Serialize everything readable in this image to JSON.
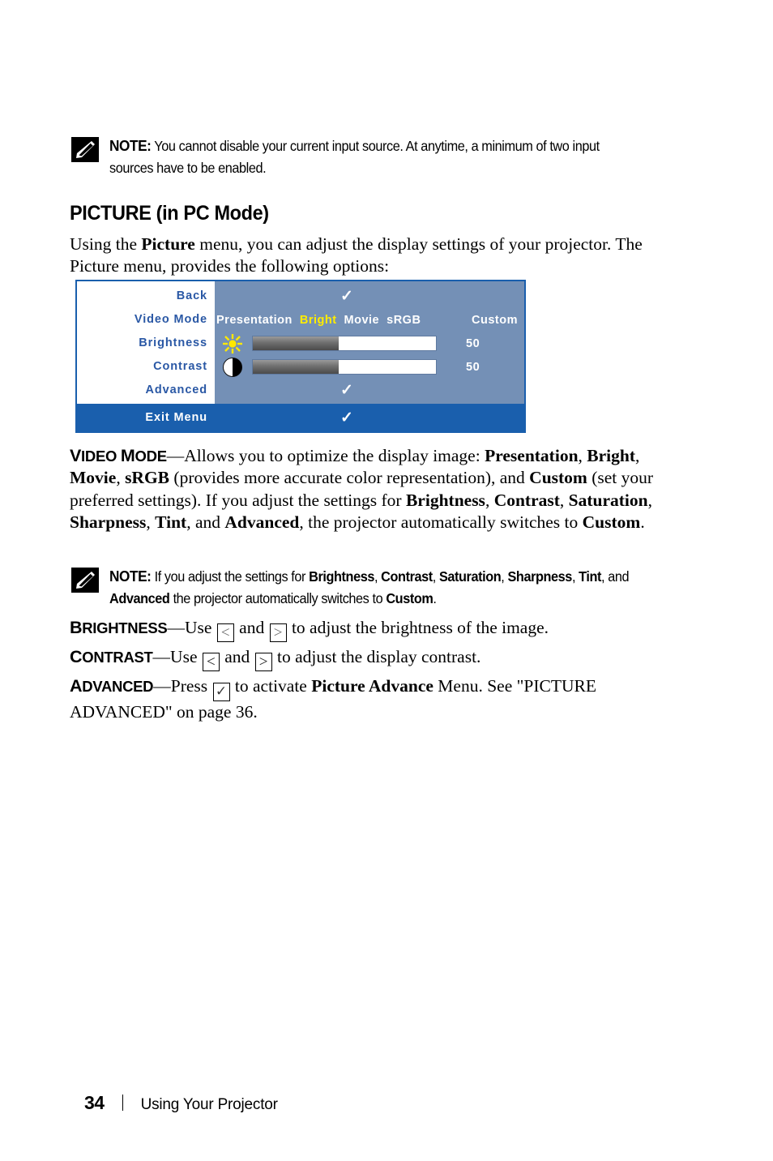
{
  "notes": [
    {
      "icon": "note-pencil-icon",
      "label": "NOTE:",
      "text_html": "You cannot disable your current input source. At anytime, a minimum of two input sources have to be enabled."
    },
    {
      "icon": "note-pencil-icon",
      "label": "NOTE:",
      "text_html": "If you adjust the settings for <b>Brightness</b>, <b>Contrast</b>, <b>Saturation</b>, <b>Sharpness</b>, <b>Tint</b>, and <b>Advanced</b> the projector automatically switches to <b>Custom</b>."
    }
  ],
  "heading": "PICTURE (in PC Mode)",
  "intro_html": "Using the <b>Picture</b> menu, you can adjust the display settings of your projector. The Picture menu, provides the following options:",
  "osd": {
    "colors": {
      "border": "#1a5fad",
      "panel": "#7490b6",
      "label_bg": "#ffffff",
      "label_text": "#2a58a5",
      "exit_bar": "#1a5fad",
      "highlight": "#ffec00"
    },
    "rows": [
      {
        "label": "Back",
        "type": "check",
        "check": "✓"
      },
      {
        "label": "Video Mode",
        "type": "modes"
      },
      {
        "label": "Brightness",
        "type": "slider",
        "icon": "sun-icon",
        "value": "50",
        "fill_percent": 47
      },
      {
        "label": "Contrast",
        "type": "slider",
        "icon": "contrast-circle-icon",
        "value": "50",
        "fill_percent": 47
      },
      {
        "label": "Advanced",
        "type": "check",
        "check": "✓"
      }
    ],
    "video_modes": [
      {
        "label": "Presentation",
        "selected": false
      },
      {
        "label": "Bright",
        "selected": true
      },
      {
        "label": "Movie",
        "selected": false
      },
      {
        "label": "sRGB",
        "selected": false
      },
      {
        "label": "Custom",
        "selected": false
      }
    ],
    "exit": {
      "label": "Exit Menu",
      "check": "✓"
    }
  },
  "body": {
    "video_mode_html": "<span class=\"term\"><span class=\"cap\">V</span>IDEO <span class=\"cap\">M</span>ODE</span>—Allows you to optimize the display image: <b>Presentation</b>, <b>Bright</b>, <b>Movie</b>, <b>sRGB</b> (provides more accurate color representation), and <b>Custom</b> (set your preferred settings). If you adjust the settings for <b>Brightness</b>, <b>Contrast</b>, <b>Saturation</b>, <b>Sharpness</b>, <b>Tint</b>, and <b>Advanced</b>, the projector automatically switches to <b>Custom</b>.",
    "brightness_html": "<span class=\"term\"><span class=\"cap\">B</span>RIGHTNESS</span>—Use <span class=\"keybox\">&lt;</span> and <span class=\"keybox\">&gt;</span> to adjust the brightness of the image.",
    "contrast_html": "<span class=\"term\"><span class=\"cap\">C</span>ONTRAST</span>—Use <span class=\"keybox dark\">&lt;</span> and <span class=\"keybox dark\">&gt;</span> to adjust the display contrast.",
    "advanced_html": "<span class=\"term\"><span class=\"cap\">A</span>DVANCED</span>—Press <span class=\"keybox chk\">✓</span> to activate <b>Picture Advance</b> Menu. See \"PICTURE ADVANCED\" on page 36."
  },
  "footer": {
    "page_number": "34",
    "section": "Using Your Projector"
  }
}
